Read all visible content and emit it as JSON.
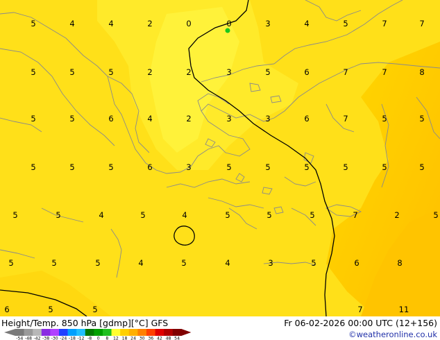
{
  "map": {
    "contour_values": [
      {
        "text": "5",
        "col": 0,
        "row": 0
      },
      {
        "text": "4",
        "col": 1,
        "row": 0
      },
      {
        "text": "4",
        "col": 2,
        "row": 0
      },
      {
        "text": "2",
        "col": 3,
        "row": 0
      },
      {
        "text": "0",
        "col": 4,
        "row": 0
      },
      {
        "text": "0",
        "col": 5,
        "row": 0
      },
      {
        "text": "3",
        "col": 6,
        "row": 0
      },
      {
        "text": "4",
        "col": 7,
        "row": 0
      },
      {
        "text": "5",
        "col": 8,
        "row": 0
      },
      {
        "text": "7",
        "col": 9,
        "row": 0
      },
      {
        "text": "7",
        "col": 10,
        "row": 0
      },
      {
        "text": "5",
        "col": 0,
        "row": 1
      },
      {
        "text": "5",
        "col": 1,
        "row": 1
      },
      {
        "text": "5",
        "col": 2,
        "row": 1
      },
      {
        "text": "2",
        "col": 3,
        "row": 1
      },
      {
        "text": "2",
        "col": 4,
        "row": 1
      },
      {
        "text": "3",
        "col": 5,
        "row": 1
      },
      {
        "text": "5",
        "col": 6,
        "row": 1
      },
      {
        "text": "6",
        "col": 7,
        "row": 1
      },
      {
        "text": "7",
        "col": 8,
        "row": 1
      },
      {
        "text": "7",
        "col": 9,
        "row": 1
      },
      {
        "text": "8",
        "col": 10,
        "row": 1
      },
      {
        "text": "5",
        "col": 0,
        "row": 2
      },
      {
        "text": "5",
        "col": 1,
        "row": 2
      },
      {
        "text": "6",
        "col": 2,
        "row": 2
      },
      {
        "text": "4",
        "col": 3,
        "row": 2
      },
      {
        "text": "2",
        "col": 4,
        "row": 2
      },
      {
        "text": "3",
        "col": 5,
        "row": 2
      },
      {
        "text": "3",
        "col": 6,
        "row": 2
      },
      {
        "text": "6",
        "col": 7,
        "row": 2
      },
      {
        "text": "7",
        "col": 8,
        "row": 2
      },
      {
        "text": "5",
        "col": 9,
        "row": 2
      },
      {
        "text": "5",
        "col": 10,
        "row": 2
      },
      {
        "text": "5",
        "col": 0,
        "row": 3
      },
      {
        "text": "5",
        "col": 1,
        "row": 3
      },
      {
        "text": "5",
        "col": 2,
        "row": 3
      },
      {
        "text": "6",
        "col": 3,
        "row": 3
      },
      {
        "text": "3",
        "col": 4,
        "row": 3
      },
      {
        "text": "5",
        "col": 5,
        "row": 3
      },
      {
        "text": "5",
        "col": 6,
        "row": 3
      },
      {
        "text": "5",
        "col": 7,
        "row": 3
      },
      {
        "text": "5",
        "col": 8,
        "row": 3
      },
      {
        "text": "5",
        "col": 9,
        "row": 3
      },
      {
        "text": "5",
        "col": 10,
        "row": 3
      },
      {
        "text": "5",
        "col": 0,
        "row": 4
      },
      {
        "text": "5",
        "col": 1,
        "row": 4
      },
      {
        "text": "4",
        "col": 2,
        "row": 4
      },
      {
        "text": "5",
        "col": 3,
        "row": 4
      },
      {
        "text": "4",
        "col": 4,
        "row": 4
      },
      {
        "text": "5",
        "col": 5,
        "row": 4
      },
      {
        "text": "5",
        "col": 6,
        "row": 4
      },
      {
        "text": "5",
        "col": 7,
        "row": 4
      },
      {
        "text": "7",
        "col": 8,
        "row": 4
      },
      {
        "text": "2",
        "col": 9,
        "row": 4
      },
      {
        "text": "5",
        "col": 10,
        "row": 4
      },
      {
        "text": "5",
        "col": 0,
        "row": 5
      },
      {
        "text": "5",
        "col": 1,
        "row": 5
      },
      {
        "text": "5",
        "col": 2,
        "row": 5
      },
      {
        "text": "4",
        "col": 3,
        "row": 5
      },
      {
        "text": "5",
        "col": 4,
        "row": 5
      },
      {
        "text": "4",
        "col": 5,
        "row": 5
      },
      {
        "text": "3",
        "col": 6,
        "row": 5
      },
      {
        "text": "5",
        "col": 7,
        "row": 5
      },
      {
        "text": "6",
        "col": 8,
        "row": 5
      },
      {
        "text": "8",
        "col": 9,
        "row": 5
      },
      {
        "text": "6",
        "col": 0,
        "row": 6
      },
      {
        "text": "5",
        "col": 1,
        "row": 6
      },
      {
        "text": "5",
        "col": 2,
        "row": 6
      },
      {
        "text": "7",
        "col": 8,
        "row": 6
      },
      {
        "text": "11",
        "col": 9,
        "row": 6
      }
    ]
  },
  "footer": {
    "title": "Height/Temp. 850 hPa [gdmp][°C] GFS",
    "datetime": "Fr 06-02-2026 00:00 UTC (12+156)",
    "credit": "©weatheronline.co.uk"
  },
  "legend": {
    "labels": [
      "-54",
      "-48",
      "-42",
      "-38",
      "-30",
      "-24",
      "-18",
      "-12",
      "-8",
      "0",
      "8",
      "12",
      "18",
      "24",
      "30",
      "36",
      "42",
      "48",
      "54"
    ],
    "colors": [
      "#7a7a7a",
      "#9a9a9a",
      "#b8b8b8",
      "#8a2be2",
      "#b040ff",
      "#2040ff",
      "#00a0ff",
      "#20c0ff",
      "#007a00",
      "#00a000",
      "#20c020",
      "#ffff30",
      "#ffd000",
      "#ffb000",
      "#ff8000",
      "#ff4000",
      "#e00000",
      "#b00000",
      "#800000"
    ]
  }
}
